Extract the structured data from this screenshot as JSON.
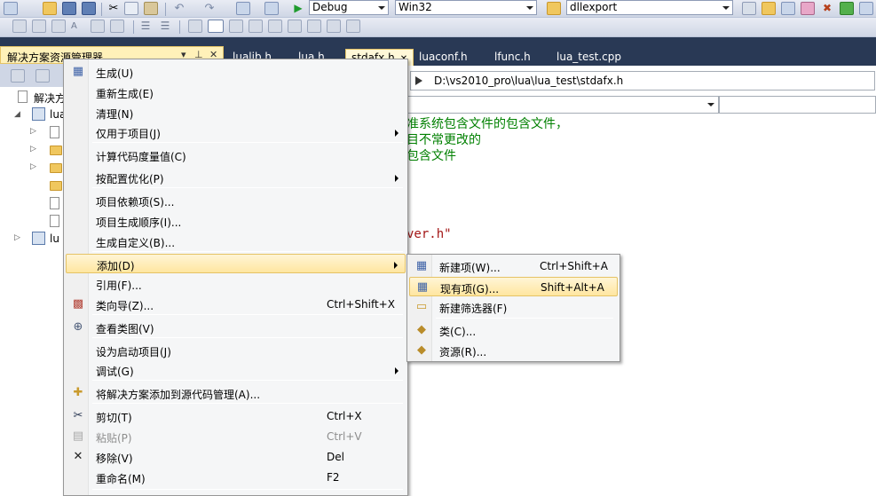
{
  "toolbar": {
    "config": "Debug",
    "platform": "Win32",
    "startup_project": "dllexport"
  },
  "solution_explorer": {
    "title": "解决方案资源管理器",
    "tree": {
      "solution_label": "解决方",
      "project_label": "lua",
      "project2_label": "lu"
    }
  },
  "tabs": [
    "lualib.h",
    "lua.h",
    "stdafx.h",
    "luaconf.h",
    "lfunc.h",
    "lua_test.cpp"
  ],
  "editor": {
    "path": "D:\\vs2010_pro\\lua\\lua_test\\stdafx.h",
    "code_lines": [
      "准系统包含文件的包含文件，",
      "目不常更改的",
      "包含文件"
    ],
    "code_string": "ver.h\""
  },
  "context_menu": {
    "items": [
      {
        "label": "生成(U)",
        "icon": "build-icon",
        "shortcut": ""
      },
      {
        "label": "重新生成(E)",
        "icon": "",
        "shortcut": ""
      },
      {
        "label": "清理(N)",
        "icon": "",
        "shortcut": ""
      },
      {
        "label": "仅用于项目(J)",
        "icon": "",
        "shortcut": "",
        "submenu": true
      },
      {
        "label": "计算代码度量值(C)",
        "icon": "",
        "shortcut": ""
      },
      {
        "label": "按配置优化(P)",
        "icon": "",
        "shortcut": "",
        "submenu": true
      },
      {
        "label": "项目依赖项(S)...",
        "icon": "",
        "shortcut": ""
      },
      {
        "label": "项目生成顺序(I)...",
        "icon": "",
        "shortcut": ""
      },
      {
        "label": "生成自定义(B)...",
        "icon": "",
        "shortcut": ""
      },
      {
        "label": "添加(D)",
        "icon": "",
        "shortcut": "",
        "submenu": true
      },
      {
        "label": "引用(F)...",
        "icon": "",
        "shortcut": ""
      },
      {
        "label": "类向导(Z)...",
        "icon": "class-wizard-icon",
        "shortcut": "Ctrl+Shift+X"
      },
      {
        "label": "查看类图(V)",
        "icon": "class-diagram-icon",
        "shortcut": ""
      },
      {
        "label": "设为启动项目(J)",
        "icon": "",
        "shortcut": ""
      },
      {
        "label": "调试(G)",
        "icon": "",
        "shortcut": "",
        "submenu": true
      },
      {
        "label": "将解决方案添加到源代码管理(A)...",
        "icon": "source-control-icon",
        "shortcut": ""
      },
      {
        "label": "剪切(T)",
        "icon": "cut-icon",
        "shortcut": "Ctrl+X"
      },
      {
        "label": "粘贴(P)",
        "icon": "paste-icon",
        "shortcut": "Ctrl+V",
        "disabled": true
      },
      {
        "label": "移除(V)",
        "icon": "remove-icon",
        "shortcut": "Del"
      },
      {
        "label": "重命名(M)",
        "icon": "",
        "shortcut": "F2"
      }
    ]
  },
  "submenu": {
    "items": [
      {
        "label": "新建项(W)...",
        "icon": "new-item-icon",
        "shortcut": "Ctrl+Shift+A"
      },
      {
        "label": "现有项(G)...",
        "icon": "existing-item-icon",
        "shortcut": "Shift+Alt+A"
      },
      {
        "label": "新建筛选器(F)",
        "icon": "new-filter-icon",
        "shortcut": ""
      },
      {
        "label": "类(C)...",
        "icon": "class-icon",
        "shortcut": ""
      },
      {
        "label": "资源(R)...",
        "icon": "resource-icon",
        "shortcut": ""
      }
    ]
  },
  "colors": {
    "frame": "#293955",
    "highlight": "#ffe6a0",
    "comment": "#008000",
    "string": "#a31515"
  }
}
